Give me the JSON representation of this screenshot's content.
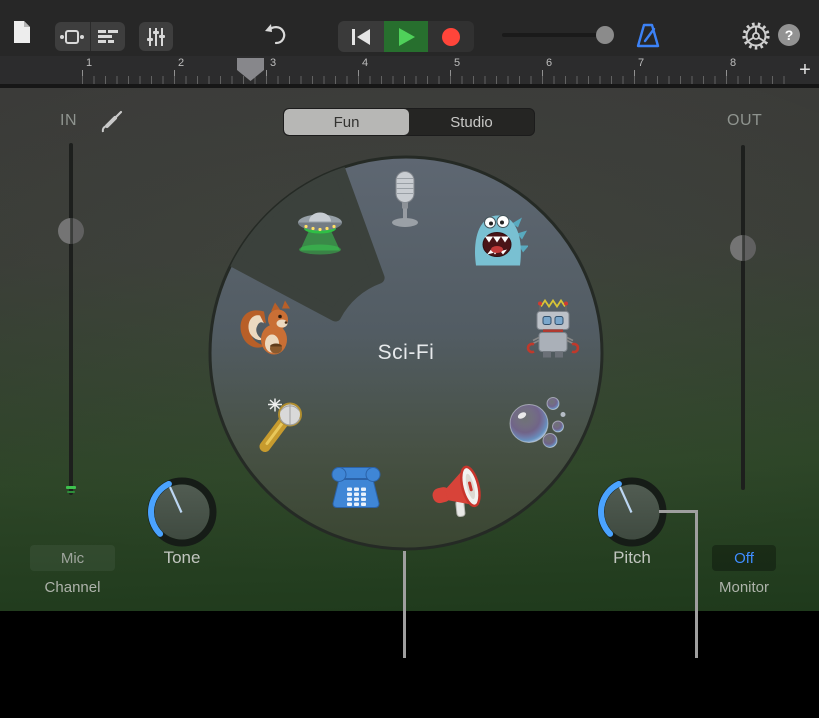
{
  "toolbar": {
    "icons": [
      "document-icon",
      "connections-icon",
      "tracks-icon",
      "mixer-icon",
      "undo-icon",
      "go-to-beginning-icon",
      "play-icon",
      "record-icon",
      "volume-slider",
      "metronome-icon",
      "settings-gear-icon",
      "help-icon"
    ],
    "help_label": "?"
  },
  "ruler": {
    "numbers": [
      "1",
      "2",
      "3",
      "4",
      "5",
      "6",
      "7",
      "8"
    ],
    "add_track_label": "+"
  },
  "mode_switch": {
    "options": [
      "Fun",
      "Studio"
    ],
    "selected": "Fun"
  },
  "io": {
    "in_label": "IN",
    "out_label": "OUT",
    "input_icon": "audio-jack-icon"
  },
  "wheel": {
    "selected_label": "Sci-Fi",
    "presets": [
      {
        "icon": "ufo-icon",
        "selected": true
      },
      {
        "icon": "studio-mic-icon",
        "selected": false
      },
      {
        "icon": "monster-icon",
        "selected": false
      },
      {
        "icon": "robot-icon",
        "selected": false
      },
      {
        "icon": "bubbles-icon",
        "selected": false
      },
      {
        "icon": "megaphone-icon",
        "selected": false
      },
      {
        "icon": "telephone-icon",
        "selected": false
      },
      {
        "icon": "glowing-mic-icon",
        "selected": false
      },
      {
        "icon": "squirrel-icon",
        "selected": false
      }
    ]
  },
  "knobs": [
    {
      "label": "Tone"
    },
    {
      "label": "Pitch"
    }
  ],
  "channel": {
    "button_label": "Mic",
    "label": "Channel"
  },
  "monitor": {
    "button_label": "Off",
    "label": "Monitor"
  },
  "colors": {
    "accent_blue": "#3c82f7",
    "play_green": "#4fd15a",
    "record_red": "#ff453a",
    "selected_segment": "#b7b7b5",
    "panel_green": "#23401f",
    "wheel_top": "#5e6772",
    "wheel_bottom": "#3a4631"
  }
}
